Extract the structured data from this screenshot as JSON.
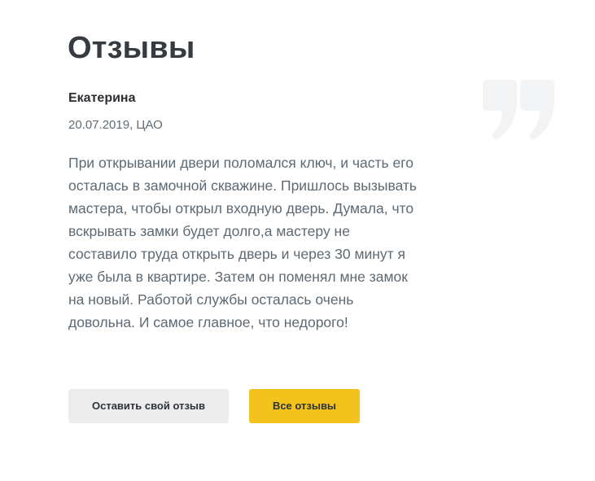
{
  "section": {
    "title": "Отзывы",
    "quote_icon": "quote-mark-icon"
  },
  "review": {
    "author": "Екатерина",
    "meta": "20.07.2019, ЦАО",
    "text": "При открывании двери поломался ключ, и часть его осталась в замочной скважине. Пришлось вызывать мастера, чтобы открыл входную дверь. Думала, что вскрывать замки будет долго,а мастеру не составило труда открыть дверь и через 30 минут я уже была в квартире. Затем он поменял мне замок на новый. Работой службы осталась очень довольна. И самое главное, что недорого!"
  },
  "actions": {
    "leave_review_label": "Оставить свой отзыв",
    "all_reviews_label": "Все отзывы"
  },
  "colors": {
    "accent": "#f3c21c",
    "secondary_button": "#ececed",
    "quote_mark": "#f2f3f4"
  }
}
